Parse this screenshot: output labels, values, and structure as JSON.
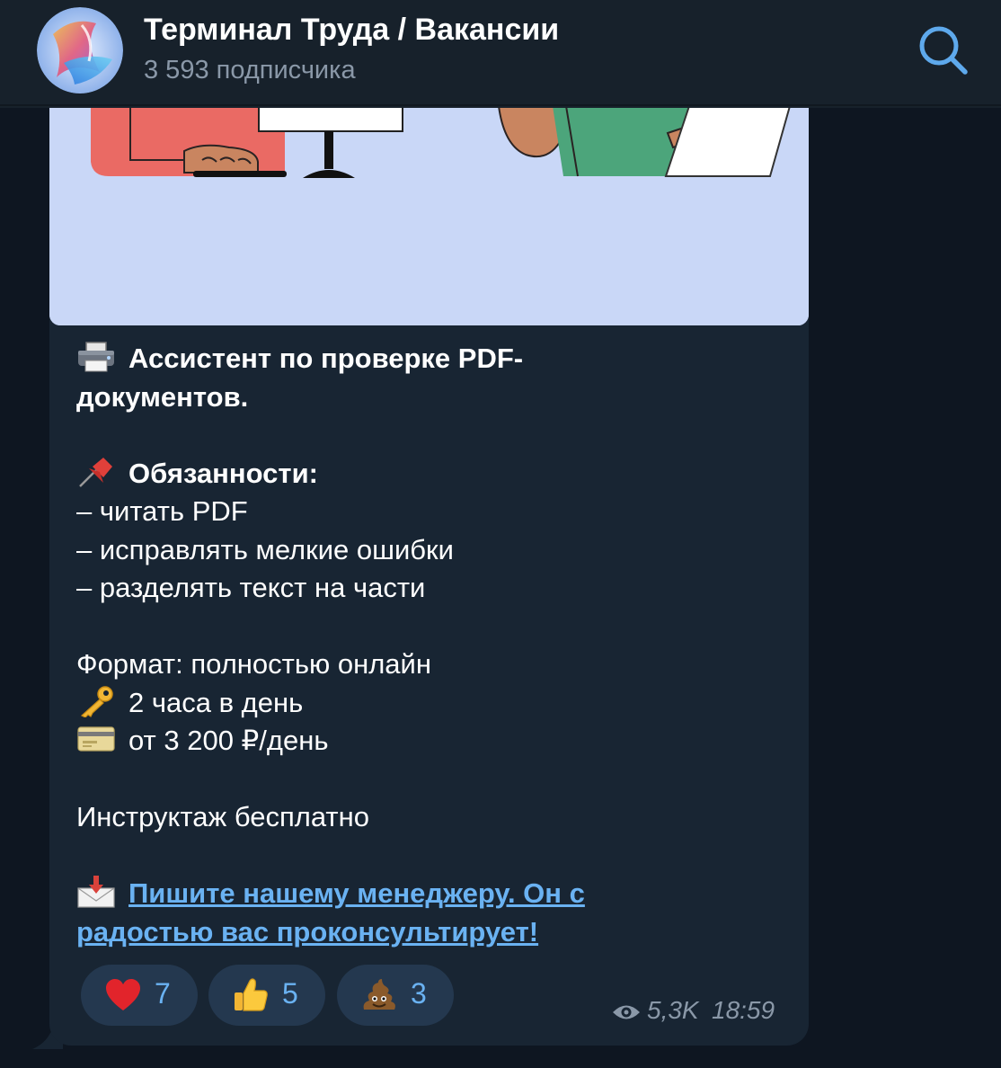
{
  "header": {
    "title": "Терминал Труда / Вакансии",
    "subscribers": "3 593 подписчика",
    "search_icon": "search-icon"
  },
  "post": {
    "title_emoji": "printer",
    "title_line1": "Ассистент по проверке PDF-",
    "title_line2": "документов.",
    "duties_emoji": "pushpin",
    "duties_heading": "Обязанности:",
    "duties": [
      "– читать PDF",
      "– исправлять мелкие ошибки",
      "– разделять текст на части"
    ],
    "format": "Формат: полностью онлайн",
    "hours_emoji": "key",
    "hours": "2 часа в день",
    "pay_emoji": "credit-card",
    "pay": "от 3 200 ₽/день",
    "training": "Инструктаж бесплатно",
    "link_emoji": "envelope-with-arrow",
    "link_line1": "Пишите нашему менеджеру. Он с",
    "link_line2": "радостью вас проконсультирует!",
    "link_color": "#6ab2f2"
  },
  "reactions": [
    {
      "emoji": "red-heart",
      "count": "7"
    },
    {
      "emoji": "thumbs-up",
      "count": "5"
    },
    {
      "emoji": "pile-of-poo",
      "count": "3"
    }
  ],
  "meta": {
    "views": "5,3K",
    "time": "18:59"
  },
  "colors": {
    "background": "#0e1621",
    "header": "#17212b",
    "bubble": "#182533",
    "accent": "#6ab2f2",
    "photo_bg": "#c9d7f7"
  }
}
